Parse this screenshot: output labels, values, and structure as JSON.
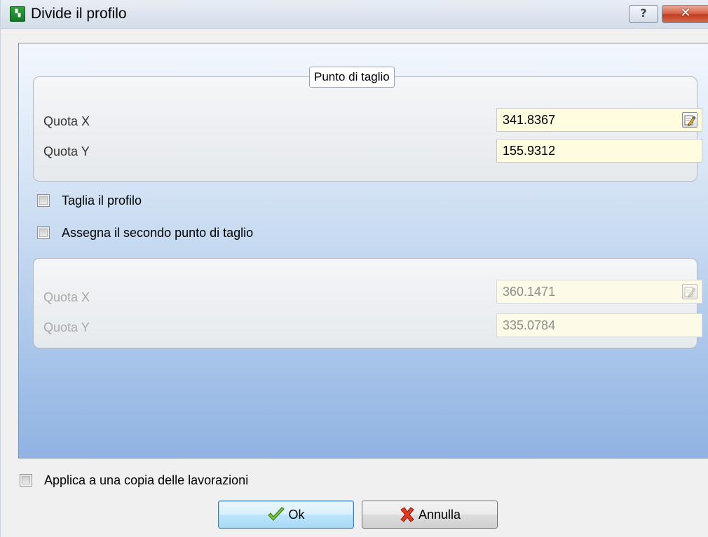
{
  "window": {
    "title": "Divide il profilo",
    "help_button": "?",
    "close_button": "✕"
  },
  "group1": {
    "legend": "Punto di taglio",
    "quota_x_label": "Quota X",
    "quota_x_value": "341.8367",
    "quota_y_label": "Quota Y",
    "quota_y_value": "155.9312"
  },
  "options": {
    "taglia_profilo": "Taglia il profilo",
    "taglia_profilo_checked": false,
    "secondo_punto": "Assegna il secondo punto di taglio",
    "secondo_punto_checked": false
  },
  "group2": {
    "quota_x_label": "Quota X",
    "quota_x_value": "360.1471",
    "quota_y_label": "Quota Y",
    "quota_y_value": "335.0784",
    "enabled": false
  },
  "footer": {
    "applica_copia": "Applica a una copia delle lavorazioni",
    "applica_copia_checked": false,
    "ok_label": "Ok",
    "cancel_label": "Annulla"
  },
  "icons": {
    "app": "app-logo-icon",
    "edit": "edit-pencil-icon",
    "ok": "check-icon",
    "cancel": "red-x-icon"
  },
  "colors": {
    "input_background": "#fffce0",
    "content_gradient_top": "#f2f7fd",
    "content_gradient_bottom": "#90b3e3",
    "ok_button": "#bee6fd"
  }
}
